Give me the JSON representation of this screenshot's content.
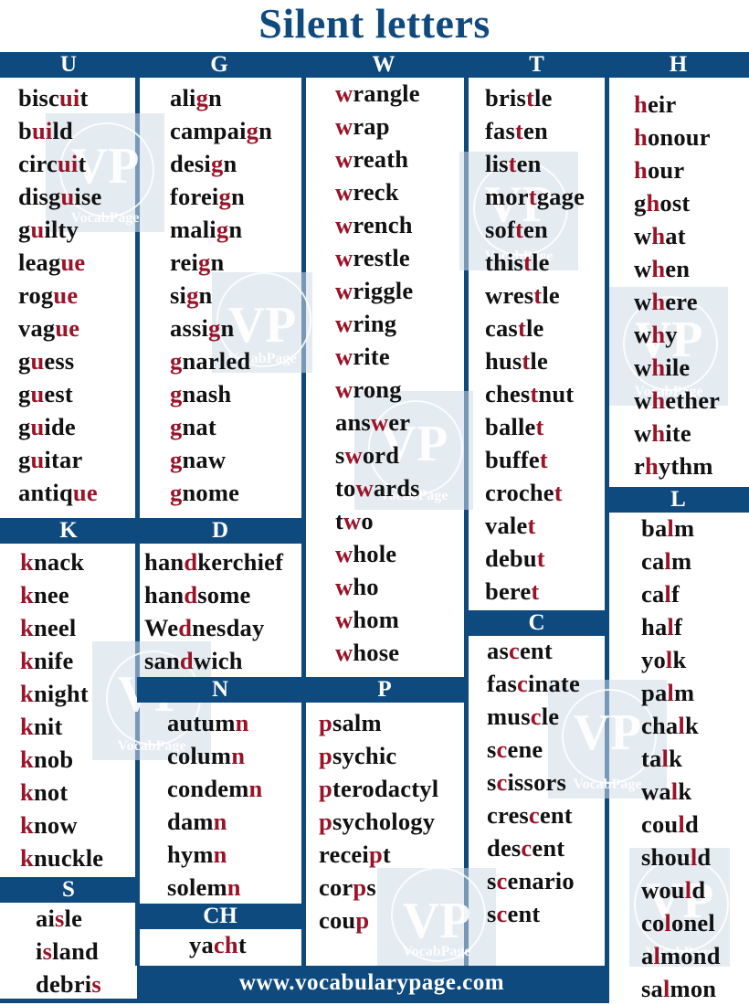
{
  "title": "Silent letters",
  "footer": "www.vocabularypage.com",
  "watermark": {
    "mark": "VP",
    "brand": "VocabPage"
  },
  "colors": {
    "brand_blue": "#0e4a7e",
    "silent_red": "#9a1327",
    "text": "#111111"
  },
  "sections": {
    "U": {
      "header": "U",
      "words": [
        [
          "bisc",
          "ui",
          "t"
        ],
        [
          "b",
          "ui",
          "ld"
        ],
        [
          "circ",
          "ui",
          "t"
        ],
        [
          "disg",
          "u",
          "ise"
        ],
        [
          "g",
          "u",
          "ilty"
        ],
        [
          "leag",
          "ue",
          ""
        ],
        [
          "rog",
          "ue",
          ""
        ],
        [
          "vag",
          "ue",
          ""
        ],
        [
          "g",
          "u",
          "ess"
        ],
        [
          "g",
          "u",
          "est"
        ],
        [
          "g",
          "u",
          "ide"
        ],
        [
          "g",
          "u",
          "itar"
        ],
        [
          "antiq",
          "ue",
          ""
        ]
      ]
    },
    "G": {
      "header": "G",
      "words": [
        [
          "ali",
          "g",
          "n"
        ],
        [
          "campai",
          "g",
          "n"
        ],
        [
          "desi",
          "g",
          "n"
        ],
        [
          "forei",
          "g",
          "n"
        ],
        [
          "mali",
          "g",
          "n"
        ],
        [
          "rei",
          "g",
          "n"
        ],
        [
          "si",
          "g",
          "n"
        ],
        [
          "assi",
          "g",
          "n"
        ],
        [
          "",
          "g",
          "narled"
        ],
        [
          "",
          "g",
          "nash"
        ],
        [
          "",
          "g",
          "nat"
        ],
        [
          "",
          "g",
          "naw"
        ],
        [
          "",
          "g",
          "nome"
        ]
      ]
    },
    "W": {
      "header": "W",
      "words": [
        [
          "",
          "w",
          "rangle"
        ],
        [
          "",
          "w",
          "rap"
        ],
        [
          "",
          "w",
          "reath"
        ],
        [
          "",
          "w",
          "reck"
        ],
        [
          "",
          "w",
          "rench"
        ],
        [
          "",
          "w",
          "restle"
        ],
        [
          "",
          "w",
          "riggle"
        ],
        [
          "",
          "w",
          "ring"
        ],
        [
          "",
          "w",
          "rite"
        ],
        [
          "",
          "w",
          "rong"
        ],
        [
          "ans",
          "w",
          "er"
        ],
        [
          "s",
          "w",
          "ord"
        ],
        [
          "to",
          "w",
          "ards"
        ],
        [
          "t",
          "w",
          "o"
        ],
        [
          "",
          "w",
          "hole"
        ],
        [
          "",
          "w",
          "ho"
        ],
        [
          "",
          "w",
          "hom"
        ],
        [
          "",
          "w",
          "hose"
        ]
      ]
    },
    "T": {
      "header": "T",
      "words": [
        [
          "bris",
          "t",
          "le"
        ],
        [
          "fas",
          "t",
          "en"
        ],
        [
          "lis",
          "t",
          "en"
        ],
        [
          "mor",
          "t",
          "gage"
        ],
        [
          "sof",
          "t",
          "en"
        ],
        [
          "this",
          "t",
          "le"
        ],
        [
          "wres",
          "t",
          "le"
        ],
        [
          "cas",
          "t",
          "le"
        ],
        [
          "hus",
          "t",
          "le"
        ],
        [
          "ches",
          "t",
          "nut"
        ],
        [
          "balle",
          "t",
          ""
        ],
        [
          "buffe",
          "t",
          ""
        ],
        [
          "croche",
          "t",
          ""
        ],
        [
          "vale",
          "t",
          ""
        ],
        [
          "debu",
          "t",
          ""
        ],
        [
          "bere",
          "t",
          ""
        ]
      ]
    },
    "H": {
      "header": "H",
      "words": [
        [
          "",
          "h",
          "eir"
        ],
        [
          "",
          "h",
          "onour"
        ],
        [
          "",
          "h",
          "our"
        ],
        [
          "g",
          "h",
          "ost"
        ],
        [
          "w",
          "h",
          "at"
        ],
        [
          "w",
          "h",
          "en"
        ],
        [
          "w",
          "h",
          "ere"
        ],
        [
          "w",
          "h",
          "y"
        ],
        [
          "w",
          "h",
          "ile"
        ],
        [
          "w",
          "h",
          "ether"
        ],
        [
          "w",
          "h",
          "ite"
        ],
        [
          "r",
          "h",
          "ythm"
        ]
      ]
    },
    "K": {
      "header": "K",
      "words": [
        [
          "",
          "k",
          "nack"
        ],
        [
          "",
          "k",
          "nee"
        ],
        [
          "",
          "k",
          "neel"
        ],
        [
          "",
          "k",
          "nife"
        ],
        [
          "",
          "k",
          "night"
        ],
        [
          "",
          "k",
          "nit"
        ],
        [
          "",
          "k",
          "nob"
        ],
        [
          "",
          "k",
          "not"
        ],
        [
          "",
          "k",
          "now"
        ],
        [
          "",
          "k",
          "nuckle"
        ]
      ]
    },
    "D": {
      "header": "D",
      "words": [
        [
          "han",
          "d",
          "kerchief"
        ],
        [
          "han",
          "d",
          "some"
        ],
        [
          "We",
          "d",
          "nesday"
        ],
        [
          "san",
          "d",
          "wich"
        ]
      ]
    },
    "N": {
      "header": "N",
      "words": [
        [
          "autum",
          "n",
          ""
        ],
        [
          "colum",
          "n",
          ""
        ],
        [
          "condem",
          "n",
          ""
        ],
        [
          "dam",
          "n",
          ""
        ],
        [
          "hym",
          "n",
          ""
        ],
        [
          "solem",
          "n",
          ""
        ]
      ]
    },
    "P": {
      "header": "P",
      "words": [
        [
          "",
          "p",
          "salm"
        ],
        [
          "",
          "p",
          "sychic"
        ],
        [
          "",
          "p",
          "terodactyl"
        ],
        [
          "",
          "p",
          "sychology"
        ],
        [
          "recei",
          "p",
          "t"
        ],
        [
          "cor",
          "p",
          "s"
        ],
        [
          "cou",
          "p",
          ""
        ]
      ]
    },
    "C": {
      "header": "C",
      "words": [
        [
          "as",
          "c",
          "ent"
        ],
        [
          "fas",
          "c",
          "inate"
        ],
        [
          "mus",
          "c",
          "le"
        ],
        [
          "s",
          "c",
          "ene"
        ],
        [
          "s",
          "c",
          "issors"
        ],
        [
          "cres",
          "c",
          "ent"
        ],
        [
          "des",
          "c",
          "ent"
        ],
        [
          "s",
          "c",
          "enario"
        ],
        [
          "s",
          "c",
          "ent"
        ]
      ]
    },
    "L": {
      "header": "L",
      "words": [
        [
          "ba",
          "l",
          "m"
        ],
        [
          "ca",
          "l",
          "m"
        ],
        [
          "ca",
          "l",
          "f"
        ],
        [
          "ha",
          "l",
          "f"
        ],
        [
          "yo",
          "l",
          "k"
        ],
        [
          "pa",
          "l",
          "m"
        ],
        [
          "cha",
          "l",
          "k"
        ],
        [
          "ta",
          "l",
          "k"
        ],
        [
          "wa",
          "l",
          "k"
        ],
        [
          "cou",
          "l",
          "d"
        ],
        [
          "shou",
          "l",
          "d"
        ],
        [
          "wou",
          "l",
          "d"
        ],
        [
          "co",
          "l",
          "onel"
        ],
        [
          "a",
          "l",
          "mond"
        ],
        [
          "sa",
          "l",
          "mon"
        ]
      ]
    },
    "S": {
      "header": "S",
      "words": [
        [
          "ai",
          "s",
          "le"
        ],
        [
          "i",
          "s",
          "land"
        ],
        [
          "debri",
          "s",
          ""
        ]
      ]
    },
    "CH": {
      "header": "CH",
      "words": [
        [
          "ya",
          "ch",
          "t"
        ]
      ]
    }
  }
}
